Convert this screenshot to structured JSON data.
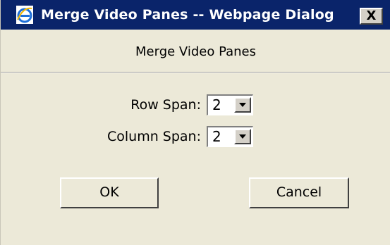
{
  "window": {
    "title": "Merge Video Panes -- Webpage Dialog",
    "app_icon": "internet-explorer-icon",
    "close_label": "X",
    "colors": {
      "titlebar": "#0a246a",
      "background": "#ece9d8"
    }
  },
  "dialog": {
    "heading": "Merge Video Panes",
    "row_span": {
      "label": "Row Span:",
      "value": "2"
    },
    "column_span": {
      "label": "Column Span:",
      "value": "2"
    },
    "ok_label": "OK",
    "cancel_label": "Cancel"
  }
}
